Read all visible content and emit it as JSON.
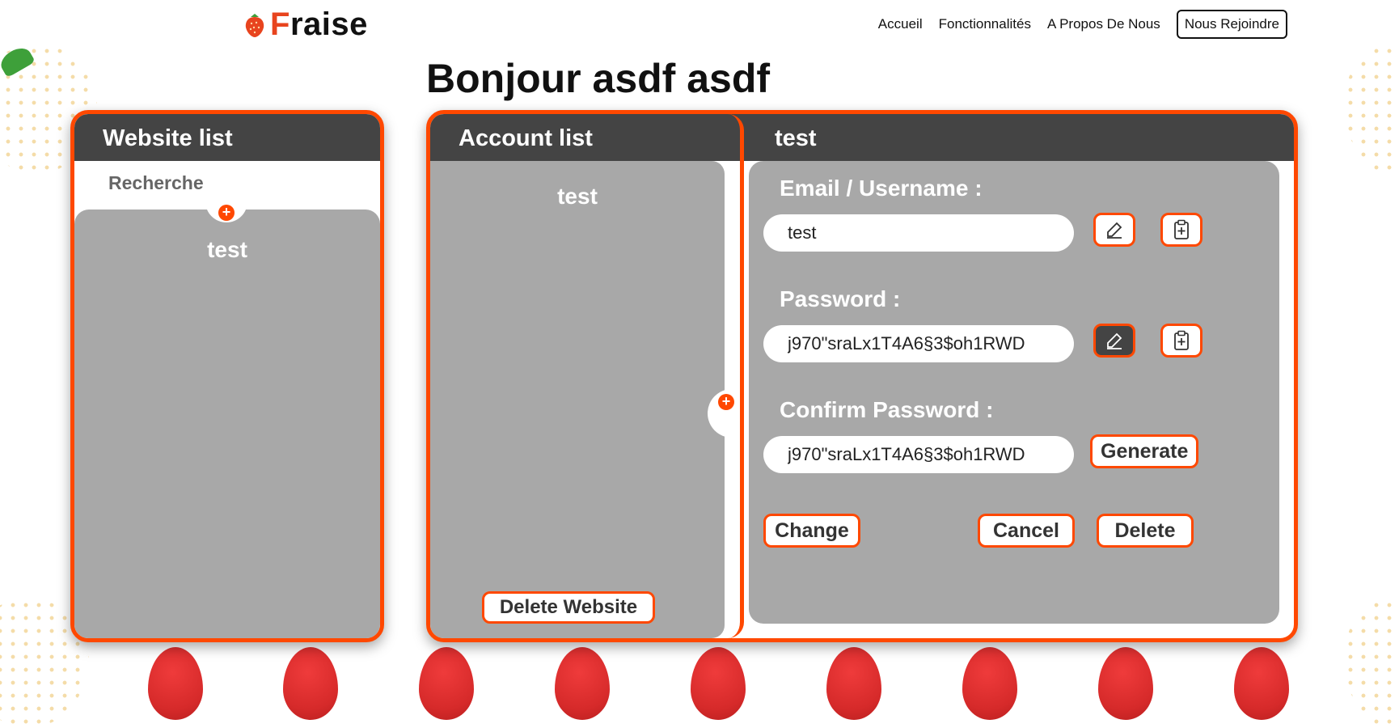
{
  "header": {
    "logo_first": "F",
    "logo_rest": "raise",
    "logo_icon": "strawberry-icon",
    "nav": [
      {
        "label": "Accueil"
      },
      {
        "label": "Fonctionnalités"
      },
      {
        "label": "A Propos De Nous"
      },
      {
        "label": "Nous Rejoindre"
      }
    ]
  },
  "greeting": "Bonjour asdf asdf",
  "website_panel": {
    "title": "Website list",
    "search_label": "Recherche",
    "add_icon": "plus-icon",
    "items": [
      "test"
    ]
  },
  "account_panel": {
    "title": "Account list",
    "items": [
      "test"
    ],
    "delete_website_label": "Delete Website",
    "add_icon": "plus-icon"
  },
  "detail_panel": {
    "title": "test",
    "email_label": "Email / Username :",
    "email_value": "test",
    "password_label": "Password :",
    "password_value": "j970\"sraLx1T4A6§3$oh1RWD",
    "confirm_label": "Confirm Password :",
    "confirm_value": "j970\"sraLx1T4A6§3$oh1RWD",
    "generate_label": "Generate",
    "change_label": "Change",
    "cancel_label": "Cancel",
    "delete_label": "Delete",
    "edit_icon": "pencil-icon",
    "copy_icon": "clipboard-icon"
  },
  "colors": {
    "accent": "#ff4800",
    "header_bg": "#444444",
    "list_bg": "#a8a8a8"
  }
}
